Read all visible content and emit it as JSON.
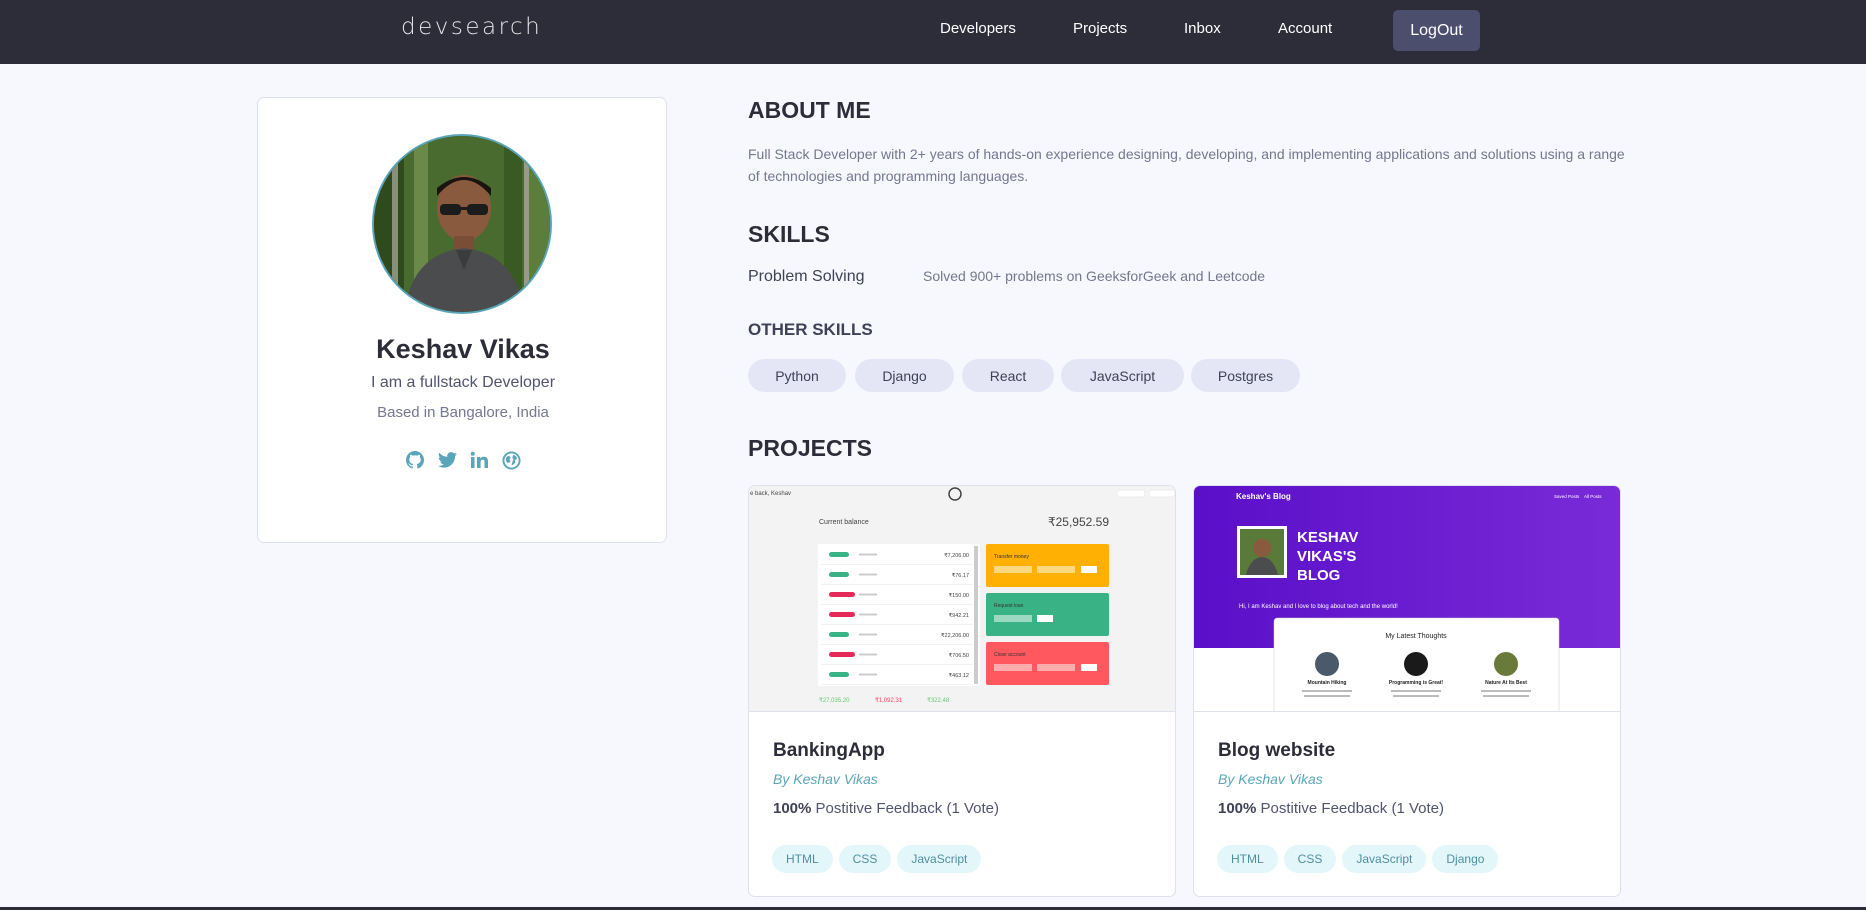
{
  "header": {
    "logo_text": "devsearch",
    "nav": [
      "Developers",
      "Projects",
      "Inbox",
      "Account"
    ],
    "logout_label": "LogOut"
  },
  "profile": {
    "name": "Keshav Vikas",
    "tagline": "I am a fullstack Developer",
    "location": "Based in Bangalore, India",
    "social_icons": [
      "github-icon",
      "twitter-icon",
      "linkedin-icon",
      "website-icon"
    ]
  },
  "about": {
    "heading": "ABOUT ME",
    "text": "Full Stack Developer with 2+ years of hands-on experience designing, developing, and implementing applications and solutions using a range of technologies and programming languages."
  },
  "skills": {
    "heading": "SKILLS",
    "items": [
      {
        "name": "Problem Solving",
        "description": "Solved 900+ problems on GeeksforGeek and Leetcode"
      }
    ]
  },
  "other_skills": {
    "heading": "OTHER SKILLS",
    "items": [
      "Python",
      "Django",
      "React",
      "JavaScript",
      "Postgres"
    ]
  },
  "projects": {
    "heading": "PROJECTS",
    "items": [
      {
        "title": "BankingApp",
        "author": "By Keshav Vikas",
        "feedback_pct": "100%",
        "feedback_text": "Postitive Feedback (1 Vote)",
        "tags": [
          "HTML",
          "CSS",
          "JavaScript"
        ],
        "thumb": {
          "greeting": "e back, Keshav",
          "balance_label": "Current balance",
          "balance": "₹25,952.59",
          "rows": [
            "₹7,206.00",
            "₹76.17",
            "₹150.00",
            "₹942.21",
            "₹22,206.00",
            "₹706.50",
            "₹463.12"
          ],
          "transfer": "Transfer money",
          "request": "Request loan",
          "close": "Close account",
          "summary_in": "₹27,035.20",
          "summary_out": "₹1,092.31",
          "summary_interest": "₹322.48"
        }
      },
      {
        "title": "Blog website",
        "author": "By Keshav Vikas",
        "feedback_pct": "100%",
        "feedback_text": "Postitive Feedback (1 Vote)",
        "tags": [
          "HTML",
          "CSS",
          "JavaScript",
          "Django"
        ],
        "thumb": {
          "brand": "Keshav's Blog",
          "links": [
            "Saved Posts",
            "All Posts"
          ],
          "hero_title": [
            "KESHAV",
            "VIKAS'S",
            "BLOG"
          ],
          "hero_sub": "Hi, I am Keshav and I love to blog about tech and the world!",
          "latest": "My Latest Thoughts",
          "posts": [
            "Mountain Hiking",
            "Programming is Great!",
            "Nature At Its Best"
          ]
        }
      }
    ]
  },
  "colors": {
    "header_bg": "#2d2d39",
    "accent": "#5aa5b9",
    "chip_bg": "#e5e6f5",
    "tag_bg": "#e3f7fb"
  }
}
